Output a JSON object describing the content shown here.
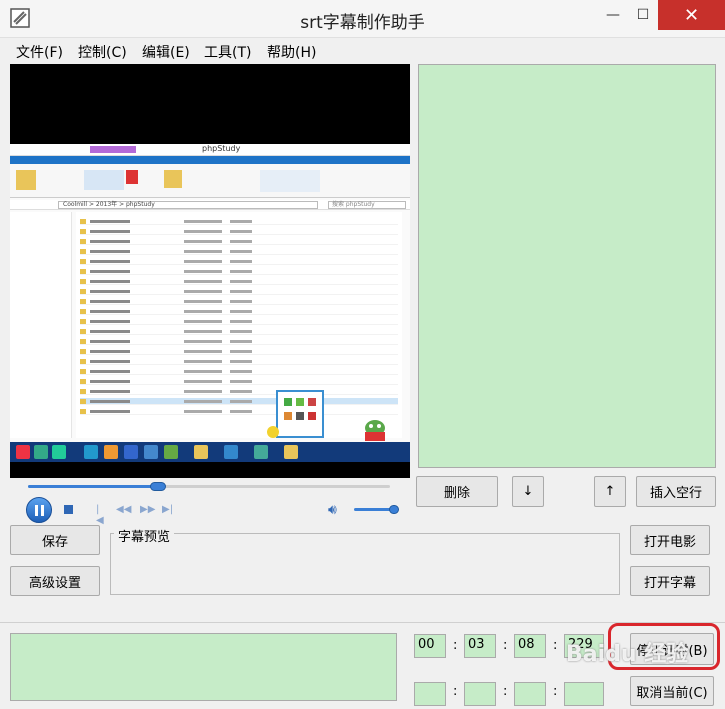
{
  "window": {
    "title": "srt字幕制作助手",
    "min_glyph": "—",
    "max_glyph": "☐",
    "close_glyph": "✕"
  },
  "menu": [
    {
      "label": "文件(F)"
    },
    {
      "label": "控制(C)"
    },
    {
      "label": "编辑(E)"
    },
    {
      "label": "工具(T)"
    },
    {
      "label": "帮助(H)"
    }
  ],
  "player": {
    "embedded_window_title": "phpStudy",
    "embedded_address": "Coolmill > 2013年 > phpStudy",
    "embedded_search": "搜索 phpStudy",
    "seek_progress_fraction": 0.36,
    "volume_fraction": 0.9
  },
  "subtitle_list": {
    "delete_label": "删除",
    "move_down_label": "↓",
    "move_up_label": "↑",
    "insert_blank_label": "插入空行"
  },
  "actions": {
    "save_label": "保存",
    "advanced_label": "高级设置",
    "open_movie_label": "打开电影",
    "open_subtitle_label": "打开字幕"
  },
  "preview": {
    "label": "字幕预览",
    "text": ""
  },
  "timer": {
    "hours": "00",
    "minutes": "03",
    "seconds": "08",
    "millis": "229",
    "stop_label": "停止计时(B)",
    "cancel_label": "取消当前(C)"
  },
  "watermark": "Baidu 经验",
  "colors": {
    "panel_green": "#c6ecc8",
    "close_red": "#c7302b",
    "highlight_red": "#d9262c",
    "accent_blue": "#3a7fd6"
  }
}
